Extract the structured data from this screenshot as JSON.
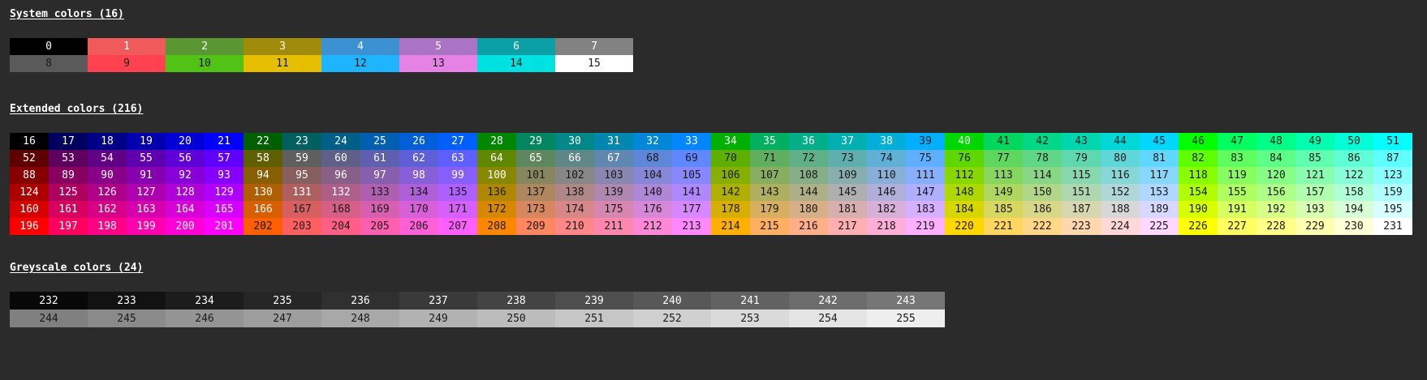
{
  "sections": {
    "system": {
      "title": "System colors (16)",
      "rows": [
        [
          {
            "n": "0",
            "bg": "#000000",
            "fg": "#ffffff"
          },
          {
            "n": "1",
            "bg": "#f05a5a",
            "fg": "#ffffff"
          },
          {
            "n": "2",
            "bg": "#5a9632",
            "fg": "#ffffff"
          },
          {
            "n": "3",
            "bg": "#a08c0a",
            "fg": "#ffffff"
          },
          {
            "n": "4",
            "bg": "#3c91d2",
            "fg": "#ffffff"
          },
          {
            "n": "5",
            "bg": "#aa73c3",
            "fg": "#ffffff"
          },
          {
            "n": "6",
            "bg": "#0aa0a5",
            "fg": "#ffffff"
          },
          {
            "n": "7",
            "bg": "#828282",
            "fg": "#ffffff"
          }
        ],
        [
          {
            "n": "8",
            "bg": "#5a5a5a",
            "fg": "#1a1a1a"
          },
          {
            "n": "9",
            "bg": "#ff4150",
            "fg": "#1a1a1a"
          },
          {
            "n": "10",
            "bg": "#50c314",
            "fg": "#1a1a1a"
          },
          {
            "n": "11",
            "bg": "#e6be00",
            "fg": "#1a1a1a"
          },
          {
            "n": "12",
            "bg": "#1eb4ff",
            "fg": "#1a1a1a"
          },
          {
            "n": "13",
            "bg": "#e682e6",
            "fg": "#1a1a1a"
          },
          {
            "n": "14",
            "bg": "#00e1e1",
            "fg": "#1a1a1a"
          },
          {
            "n": "15",
            "bg": "#ffffff",
            "fg": "#1a1a1a"
          }
        ]
      ]
    },
    "extended": {
      "title": "Extended colors (216)",
      "start": 16,
      "count": 216
    },
    "greyscale": {
      "title": "Greyscale colors (24)",
      "start": 232,
      "count": 24
    }
  },
  "colors": {
    "background": "#2b2b2b",
    "dark_text": "#1a1a1a",
    "light_text": "#ffffff"
  }
}
